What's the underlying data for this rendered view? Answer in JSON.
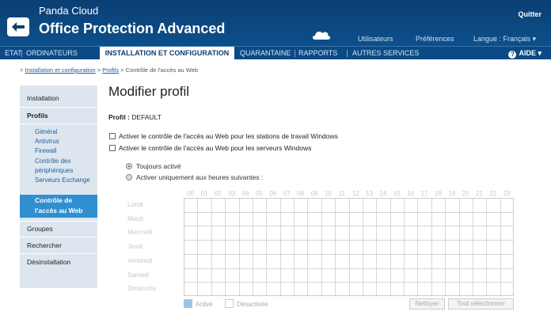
{
  "header": {
    "brand_top": "Panda Cloud",
    "brand_main": "Office Protection Advanced",
    "quit": "Quitter",
    "links": [
      "Utilisateurs",
      "Préférences",
      "Langue : Français ▾"
    ]
  },
  "nav": {
    "items": [
      "ETAT",
      "ORDINATEURS",
      "INSTALLATION ET CONFIGURATION",
      "QUARANTAINE",
      "RAPPORTS",
      "AUTRES SERVICES"
    ],
    "active": "INSTALLATION ET CONFIGURATION",
    "help": "AIDE ▾"
  },
  "breadcrumb": {
    "sep": ">",
    "links": [
      "Installation et configuration",
      "Profils"
    ],
    "current": "Contrôle de l'accès au Web"
  },
  "sidebar": {
    "installation": "Installation",
    "profils": "Profils",
    "sub": [
      "Général",
      "Antivirus",
      "Firewall",
      "Contrôle des",
      "périphériques",
      "Serveurs Exchange"
    ],
    "active_line1": "Contrôle de",
    "active_line2": "l'accès au Web",
    "groupes": "Groupes",
    "rechercher": "Rechercher",
    "desinstallation": "Désinstallation"
  },
  "main": {
    "title": "Modifier profil",
    "profil_label": "Profil :",
    "profil_value": "DEFAULT",
    "checkbox_workstations": "Activer le contrôle de l'accès au Web pour les stations de travail Windows",
    "checkbox_servers": "Activer le contrôle de l'accès au Web pour les serveurs Windows",
    "radio_always": "Toujours activé",
    "radio_hours": "Activer uniquement aux heures suivantes :",
    "radio_selected": "always"
  },
  "schedule": {
    "hours": [
      "00",
      "01",
      "02",
      "03",
      "04",
      "05",
      "06",
      "07",
      "08",
      "09",
      "10",
      "11",
      "12",
      "13",
      "14",
      "15",
      "16",
      "17",
      "18",
      "19",
      "20",
      "21",
      "22",
      "23"
    ],
    "days": [
      "Lundi",
      "Mardi",
      "Mercredi",
      "Jeudi",
      "Vendredi",
      "Samedi",
      "Dimanche"
    ],
    "legend_active": "Activé",
    "legend_inactive": "Désactivée",
    "btn_clear": "Nettoyer",
    "btn_select_all": "Tout sélectionner",
    "active_color": "#9cc6e8"
  }
}
